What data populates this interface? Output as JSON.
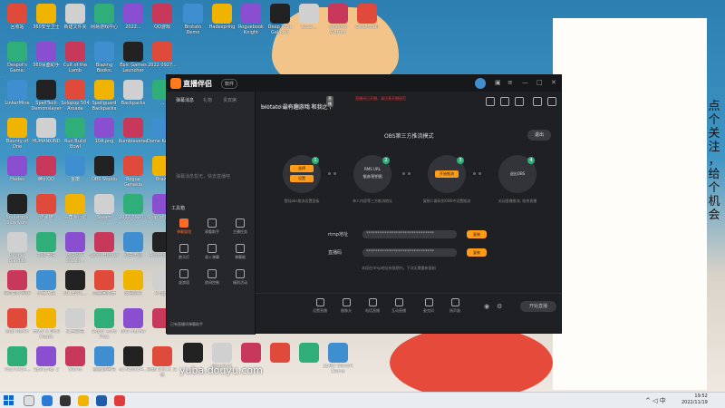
{
  "desktop": {
    "icons_col1": [
      "回收站",
      "Despot's Game: Dystopian...",
      "LinkerMine",
      "Bounty of One",
      "Hades",
      "Soulstone Survivors",
      "Rubber Bandits",
      "曹帅的小程序",
      "Bad North",
      "7be7c454..."
    ],
    "icons_col2": [
      "360安全卫士",
      "360桌面助手",
      "SpellTech Demonslayer",
      "HUMANKIND",
      "腾讯QQ",
      "炸弹猫",
      "扎破气球",
      "小兵大战",
      "Have a Nice Death",
      "Spelunky 2"
    ],
    "icons_col3": [
      "新建文件夹",
      "Cult of the Lamb",
      "Solopop 504 Arcade Dungeons",
      "Run Build Bowl",
      "金庸",
      "三角洲行动",
      "微信图片 20220...",
      "301BWIL...",
      "红色警戒",
      "Demo"
    ],
    "icons_col4": [
      "网易游戏中心",
      "Blazing Books: Magical Ash...",
      "Spellguard Backpacks",
      "10A.png",
      "OBS Studio",
      "Steam",
      "Spirit Hunter",
      "能量回收器",
      "Super Auto Pets",
      "重要说明书"
    ],
    "icons_col5": [
      "2022...",
      "Epic Games Launcher",
      "Backpacks",
      "Rumbleverse",
      "Rogue Genesia",
      "2022 0920...",
      "残生无限",
      "最后星空",
      "Idle Hunter",
      "o2-e56e54..."
    ],
    "icons_col6": [
      "QQ游戏",
      "2022 0927...",
      "...",
      "Dome Keeper",
      "Brawl",
      "Ship of Fools",
      "Atomicrops",
      "Knight",
      "",
      "新建 DOCX 文档"
    ],
    "top_row": [
      "Brotato Demo",
      "Hadespring",
      "Roguebook Knight",
      "Deep Rock Galactic",
      "2022...",
      "Shadow Warrior",
      "Groundfall"
    ],
    "bottom_row": [
      "",
      "Kingshot",
      "",
      "",
      "",
      "ZERO Sievert Demo"
    ]
  },
  "side_text": [
    "点",
    "个",
    "关",
    "注",
    "，",
    "给",
    "个",
    "机",
    "会"
  ],
  "watermark": "yuba.douyu.com",
  "app": {
    "name": "直播伴侣",
    "version": "软件",
    "left_tabs": [
      "弹幕消息",
      "礼物",
      "贵宾席"
    ],
    "message_empty": "弹幕消息暂无，快去直播吧",
    "tools_title": "工具箱",
    "tools": [
      {
        "label": "弹幕管理"
      },
      {
        "label": "观看助手"
      },
      {
        "label": "主播任务"
      },
      {
        "label": "跑马灯"
      },
      {
        "label": "录入弹幕"
      },
      {
        "label": "弹幕姬"
      },
      {
        "label": "波浪塔"
      },
      {
        "label": "房间控制"
      },
      {
        "label": "福利活动"
      }
    ],
    "left_footer": "已有直播间弹幕助手",
    "room": {
      "title": "brotato 最有趣游戏 和我之下",
      "flag": "直播",
      "warning": "直播间已开播，请注意开播规范",
      "sub": "大家好 · 斗鱼游戏 · 热度 942128 · 100"
    },
    "mode_title": "OBS第三方推流模式",
    "exit_label": "退出",
    "steps": [
      {
        "num": "1",
        "pills": [
          "选择",
          "设置"
        ],
        "caption": "登陆obs推流设置面板"
      },
      {
        "num": "2",
        "lines": [
          "RMS URL",
          "推流/密钥图"
        ],
        "caption": "单人内容等三方推流地址"
      },
      {
        "num": "3",
        "pills": [
          "开始推流"
        ],
        "caption": "复制二维码到OBS中设置推流"
      },
      {
        "num": "4",
        "lines": [
          "退出OBS"
        ],
        "caption": "关闭直播推流, 结束直播"
      }
    ],
    "rtmp_label": "rtmp地址",
    "rtmp_value": "******************************",
    "rtmp_btn": "复制",
    "key_label": "直播码",
    "key_value": "******************************",
    "key_btn": "复制",
    "hint": "本段在rtmp地址有限期内，下次无需重新复制",
    "bottom": [
      {
        "label": "设置直播"
      },
      {
        "label": "摄像头"
      },
      {
        "label": "电话直播"
      },
      {
        "label": "互动直播"
      },
      {
        "label": "麦克风"
      },
      {
        "label": "扬声器"
      }
    ],
    "live_btn": "开始直播"
  },
  "taskbar": {
    "time": "19:52",
    "date": "2022/11/19",
    "tray": "^  ◁  中"
  },
  "colors": {
    "accent": "#ff9d1a",
    "active": "#ff6a2a",
    "step_badge": "#2fae7a"
  }
}
